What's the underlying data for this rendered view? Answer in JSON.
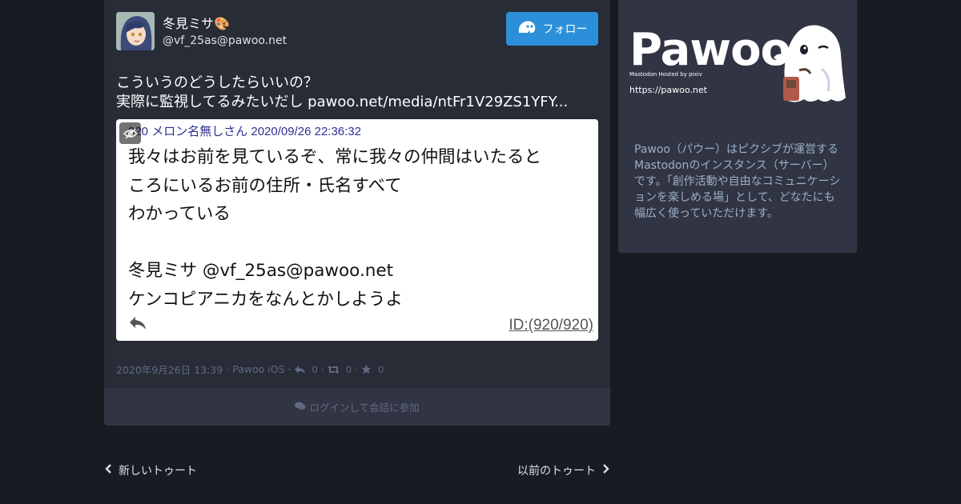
{
  "status": {
    "display_name": "冬見ミサ🎨",
    "username": "@vf_25as@pawoo.net",
    "follow_label": "フォロー",
    "text_lines": [
      "こういうのどうしたらいいの？",
      "実際に監視してるみたいだし pawoo.net/media/ntFr1V29ZS1YFY..."
    ],
    "media": {
      "header": "920 メロン名無しさん 2020/09/26 22:36:32",
      "body_lines": [
        "我々はお前を見ているぞ、常に我々の仲間はいたると",
        "ころにいるお前の住所・氏名すべて",
        "わかっている",
        "",
        "冬見ミサ @vf_25as@pawoo.net",
        "ケンコピアニカをなんとかしようよ"
      ],
      "id_label": "ID:(920/920)"
    },
    "meta": {
      "datetime": "2020年9月26日 13:39",
      "app": "Pawoo iOS",
      "sep": "·",
      "replies": "0",
      "boosts": "0",
      "favourites": "0"
    },
    "login_prompt": "ログインして会話に参加"
  },
  "sidebar": {
    "logo_text": "Pawoo",
    "hosted_by": "Mastodon Hosted by pixiv",
    "url": "https://pawoo.net",
    "description": "Pawoo（パウー）はピクシブが運営するMastodonのインスタンス（サーバー）です。「創作活動や自由なコミュニケーションを楽しめる場」として、どなたにも幅広く使っていただけます。"
  },
  "pagination": {
    "newer": "新しいトゥート",
    "older": "以前のトゥート"
  },
  "colors": {
    "background": "#191b22",
    "card": "#282c37",
    "accent": "#2b90d9",
    "muted": "#606984"
  }
}
